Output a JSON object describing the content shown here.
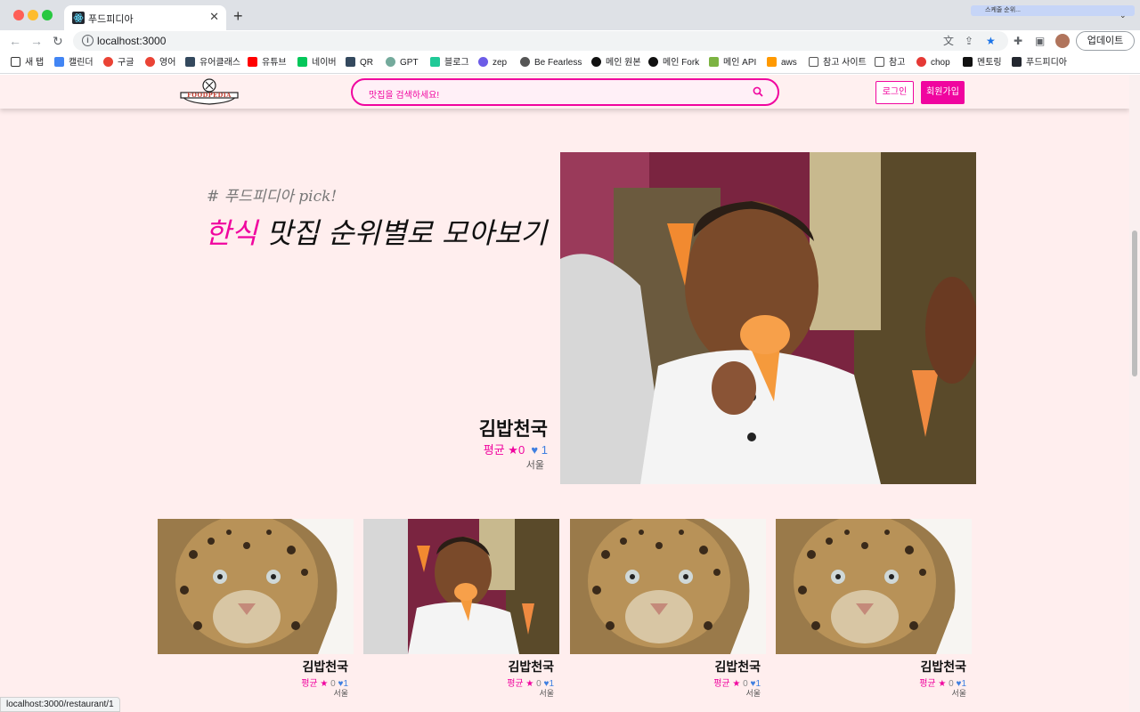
{
  "browser": {
    "tab_title": "푸드피디아",
    "profile_label": "스케줄 순위...",
    "url": "localhost:3000",
    "update_label": "업데이트",
    "bookmarks": [
      "새 탭",
      "캘린더",
      "구글",
      "영어",
      "유어클래스",
      "유튜브",
      "네이버",
      "QR",
      "GPT",
      "블로그",
      "zep",
      "Be Fearless",
      "메인 원본",
      "메인 Fork",
      "메인 API",
      "aws",
      "참고 사이트",
      "참고",
      "chop",
      "멘토링",
      "푸드피디아"
    ],
    "status_url": "localhost:3000/restaurant/1"
  },
  "header": {
    "logo_text": "FOODPEDIA",
    "search_placeholder": "맛집을 검색하세요!",
    "login_label": "로그인",
    "signup_label": "회원가입"
  },
  "pick": {
    "tag": "# 푸드피디아 pick!",
    "accent": "한식",
    "title_rest": " 맛집 순위별로 모아보기"
  },
  "featured": {
    "name": "김밥천국",
    "rating_label": "평균",
    "rating": "0",
    "likes": "1",
    "region": "서울",
    "image": "boy-eating-ice-cream"
  },
  "cards": [
    {
      "name": "김밥천국",
      "rating_label": "평균",
      "rating": "0",
      "likes": "1",
      "region": "서울",
      "image": "leopard"
    },
    {
      "name": "김밥천국",
      "rating_label": "평균",
      "rating": "0",
      "likes": "1",
      "region": "서울",
      "image": "boy-eating-ice-cream"
    },
    {
      "name": "김밥천국",
      "rating_label": "평균",
      "rating": "0",
      "likes": "1",
      "region": "서울",
      "image": "leopard"
    },
    {
      "name": "김밥천국",
      "rating_label": "평균",
      "rating": "0",
      "likes": "1",
      "region": "서울",
      "image": "leopard"
    }
  ],
  "colors": {
    "accent": "#f0059f",
    "page_bg": "#ffeeee",
    "heart": "#3f7fe0"
  }
}
